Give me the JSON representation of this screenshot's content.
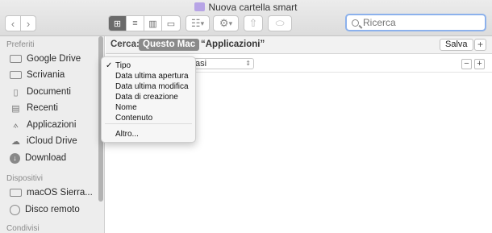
{
  "window": {
    "title": "Nuova cartella smart",
    "search_placeholder": "Ricerca"
  },
  "toolbar": {
    "back_glyph": "‹",
    "forward_glyph": "›",
    "view_modes": [
      "icon-view",
      "list-view",
      "column-view",
      "gallery-view"
    ],
    "arrange_glyph": "☷",
    "action_glyph": "⚙",
    "dropdown_glyph": "▾"
  },
  "sidebar": {
    "sections": [
      {
        "label": "Preferiti"
      },
      {
        "label": "Dispositivi"
      },
      {
        "label": "Condivisi"
      }
    ],
    "favorites": [
      {
        "label": "Google Drive",
        "icon": "folder-icon"
      },
      {
        "label": "Scrivania",
        "icon": "desktop-icon"
      },
      {
        "label": "Documenti",
        "icon": "document-icon"
      },
      {
        "label": "Recenti",
        "icon": "recents-icon"
      },
      {
        "label": "Applicazioni",
        "icon": "applications-icon"
      },
      {
        "label": "iCloud Drive",
        "icon": "cloud-icon"
      },
      {
        "label": "Download",
        "icon": "download-icon"
      }
    ],
    "devices": [
      {
        "label": "macOS Sierra...",
        "icon": "disk-icon"
      },
      {
        "label": "Disco remoto",
        "icon": "remote-disc-icon"
      }
    ]
  },
  "searchbar": {
    "label": "Cerca:",
    "scope_active": "Questo Mac",
    "scope_other": "“Applicazioni”",
    "save_label": "Salva",
    "plus_label": "+"
  },
  "criteria": {
    "popup_value": "asi",
    "minus_label": "−",
    "plus_label": "+"
  },
  "menu": {
    "items": [
      {
        "label": "Tipo",
        "checked": true
      },
      {
        "label": "Data ultima apertura",
        "checked": false
      },
      {
        "label": "Data ultima modifica",
        "checked": false
      },
      {
        "label": "Data di creazione",
        "checked": false
      },
      {
        "label": "Nome",
        "checked": false
      },
      {
        "label": "Contenuto",
        "checked": false
      },
      {
        "label": "Altro...",
        "checked": false
      }
    ],
    "check_glyph": "✓"
  },
  "colors": {
    "search_focus": "#8cb1ec",
    "scope_active_bg": "#8a8a8a",
    "folder_tint": "#b7a4e6"
  }
}
